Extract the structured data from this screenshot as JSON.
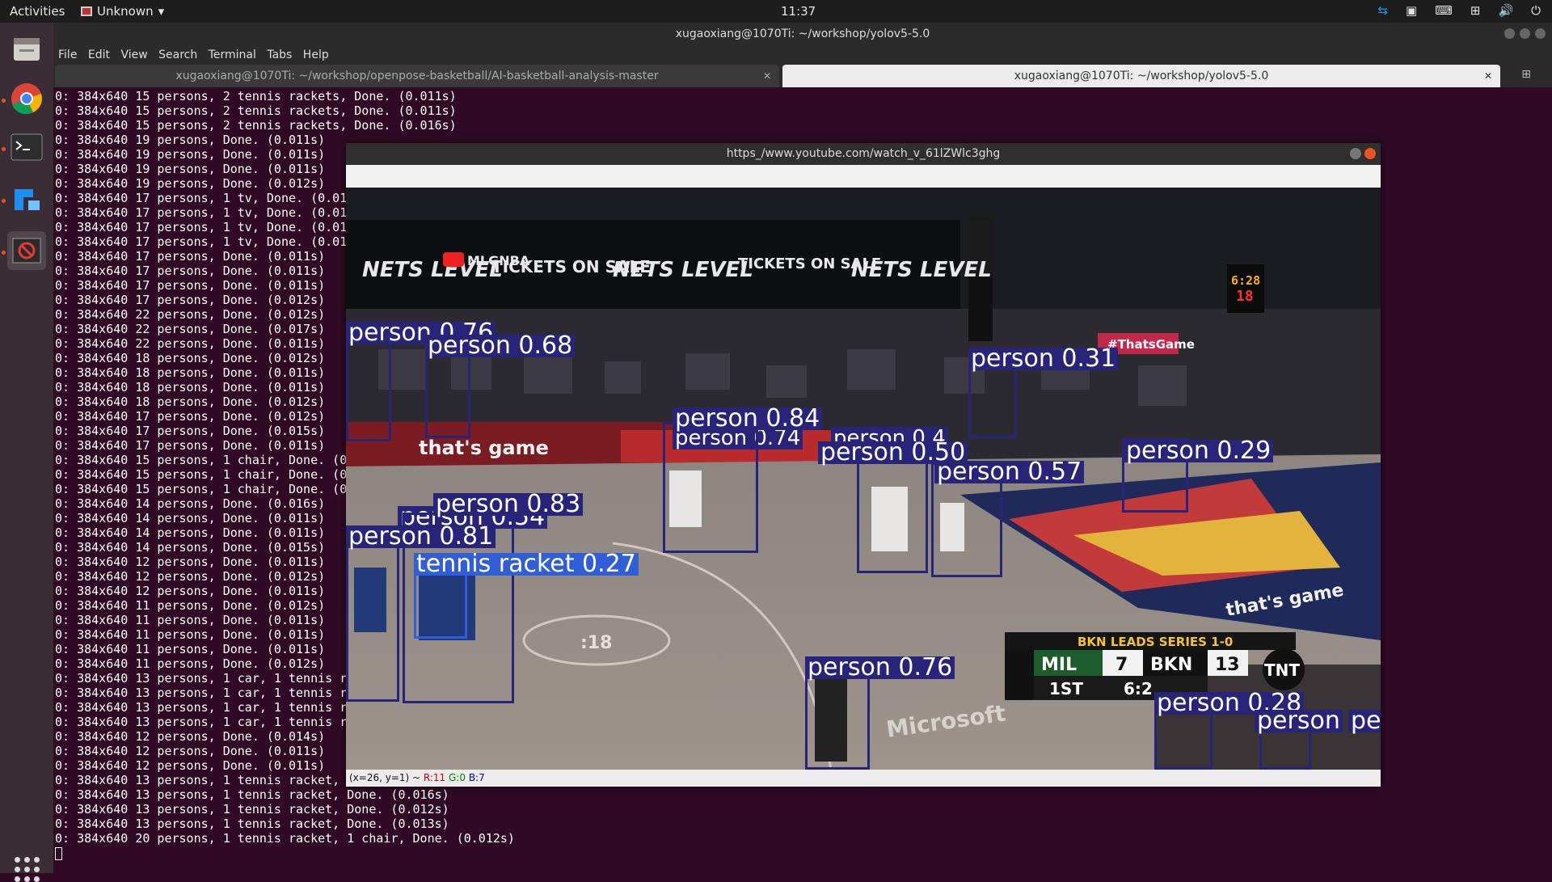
{
  "topbar": {
    "activities": "Activities",
    "app_name": "Unknown",
    "clock": "11:37"
  },
  "terminal": {
    "window_title": "xugaoxiang@1070Ti: ~/workshop/yolov5-5.0",
    "menu": [
      "File",
      "Edit",
      "View",
      "Search",
      "Terminal",
      "Tabs",
      "Help"
    ],
    "tabs": [
      {
        "label": "xugaoxiang@1070Ti: ~/workshop/openpose-basketball/AI-basketball-analysis-master",
        "active": false
      },
      {
        "label": "xugaoxiang@1070Ti: ~/workshop/yolov5-5.0",
        "active": true
      }
    ],
    "lines": [
      "0: 384x640 15 persons, 2 tennis rackets, Done. (0.011s)",
      "0: 384x640 15 persons, 2 tennis rackets, Done. (0.011s)",
      "0: 384x640 15 persons, 2 tennis rackets, Done. (0.016s)",
      "0: 384x640 19 persons, Done. (0.011s)",
      "0: 384x640 19 persons, Done. (0.011s)",
      "0: 384x640 19 persons, Done. (0.011s)",
      "0: 384x640 19 persons, Done. (0.012s)",
      "0: 384x640 17 persons, 1 tv, Done. (0.01",
      "0: 384x640 17 persons, 1 tv, Done. (0.01",
      "0: 384x640 17 persons, 1 tv, Done. (0.01",
      "0: 384x640 17 persons, 1 tv, Done. (0.01",
      "0: 384x640 17 persons, Done. (0.011s)",
      "0: 384x640 17 persons, Done. (0.011s)",
      "0: 384x640 17 persons, Done. (0.011s)",
      "0: 384x640 17 persons, Done. (0.012s)",
      "0: 384x640 22 persons, Done. (0.012s)",
      "0: 384x640 22 persons, Done. (0.017s)",
      "0: 384x640 22 persons, Done. (0.011s)",
      "0: 384x640 18 persons, Done. (0.012s)",
      "0: 384x640 18 persons, Done. (0.011s)",
      "0: 384x640 18 persons, Done. (0.011s)",
      "0: 384x640 18 persons, Done. (0.012s)",
      "0: 384x640 17 persons, Done. (0.012s)",
      "0: 384x640 17 persons, Done. (0.015s)",
      "0: 384x640 17 persons, Done. (0.011s)",
      "0: 384x640 15 persons, 1 chair, Done. (0",
      "0: 384x640 15 persons, 1 chair, Done. (0",
      "0: 384x640 15 persons, 1 chair, Done. (0",
      "0: 384x640 14 persons, Done. (0.016s)",
      "0: 384x640 14 persons, Done. (0.011s)",
      "0: 384x640 14 persons, Done. (0.011s)",
      "0: 384x640 14 persons, Done. (0.015s)",
      "0: 384x640 12 persons, Done. (0.011s)",
      "0: 384x640 12 persons, Done. (0.012s)",
      "0: 384x640 12 persons, Done. (0.011s)",
      "0: 384x640 11 persons, Done. (0.012s)",
      "0: 384x640 11 persons, Done. (0.011s)",
      "0: 384x640 11 persons, Done. (0.011s)",
      "0: 384x640 11 persons, Done. (0.011s)",
      "0: 384x640 11 persons, Done. (0.012s)",
      "0: 384x640 13 persons, 1 car, 1 tennis r",
      "0: 384x640 13 persons, 1 car, 1 tennis r",
      "0: 384x640 13 persons, 1 car, 1 tennis r",
      "0: 384x640 13 persons, 1 car, 1 tennis r",
      "0: 384x640 12 persons, Done. (0.014s)",
      "0: 384x640 12 persons, Done. (0.011s)",
      "0: 384x640 12 persons, Done. (0.011s)",
      "0: 384x640 13 persons, 1 tennis racket,",
      "0: 384x640 13 persons, 1 tennis racket, Done. (0.016s)",
      "0: 384x640 13 persons, 1 tennis racket, Done. (0.012s)",
      "0: 384x640 13 persons, 1 tennis racket, Done. (0.013s)",
      "0: 384x640 20 persons, 1 tennis racket, 1 chair, Done. (0.012s)"
    ]
  },
  "cv_window": {
    "title": "https_/www.youtube.com/watch_v_61lZWlc3ghg",
    "status": {
      "coords": "(x=26, y=1) ~",
      "r": "R:11",
      "g": "G:0",
      "b": "B:7"
    },
    "scene_texts": {
      "nets_level": "NETS LEVEL",
      "tickets": "TICKETS ON SALE",
      "mlg": "MLGNBA",
      "thats_game": "that's game",
      "hashtag": "#ThatsGame",
      "court_18": ":18",
      "microsoft": "Microsoft",
      "shot_clock": "6:28",
      "shot_clock_2": "18"
    },
    "scoreboard": {
      "banner": "BKN LEADS SERIES 1-0",
      "team1": "MIL",
      "score1": "7",
      "team2": "BKN",
      "score2": "13",
      "period": "1ST",
      "clock": "6:2",
      "network": "TNT"
    },
    "detections": [
      {
        "label": "person 0.76"
      },
      {
        "label": "person 0.68"
      },
      {
        "label": "person 0.31"
      },
      {
        "label": "person 0.84"
      },
      {
        "label": "person 0.74"
      },
      {
        "label": "person 0.50"
      },
      {
        "label": "person 0.4"
      },
      {
        "label": "person 0.57"
      },
      {
        "label": "person 0.29"
      },
      {
        "label": "person 0.83"
      },
      {
        "label": "person 0.54"
      },
      {
        "label": "person 0.81"
      },
      {
        "label": "tennis racket 0.27"
      },
      {
        "label": "person 0.76"
      },
      {
        "label": "person 0.28"
      },
      {
        "label": "person"
      },
      {
        "label": "pe"
      }
    ]
  }
}
